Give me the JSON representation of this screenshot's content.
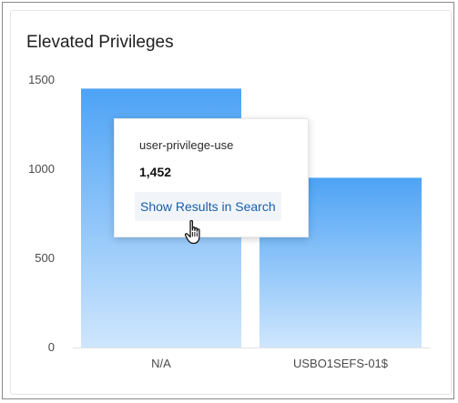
{
  "widget": {
    "title": "Elevated Privileges"
  },
  "chart_data": {
    "type": "bar",
    "categories": [
      "N/A",
      "USBO1SEFS-01$"
    ],
    "values": [
      1452,
      952
    ],
    "title": "Elevated Privileges",
    "xlabel": "",
    "ylabel": "",
    "ylim": [
      0,
      1500
    ],
    "yticks": [
      0,
      500,
      1000,
      1500
    ],
    "grid": false,
    "bar_color_top": "#4da3f5",
    "bar_color_bottom": "#cfe6fd"
  },
  "tooltip": {
    "series": "user-privilege-use",
    "value": "1,452",
    "link_label": "Show Results in Search",
    "link_color": "#1a5ea8"
  },
  "icons": {
    "cursor": "hand-pointer-icon"
  }
}
